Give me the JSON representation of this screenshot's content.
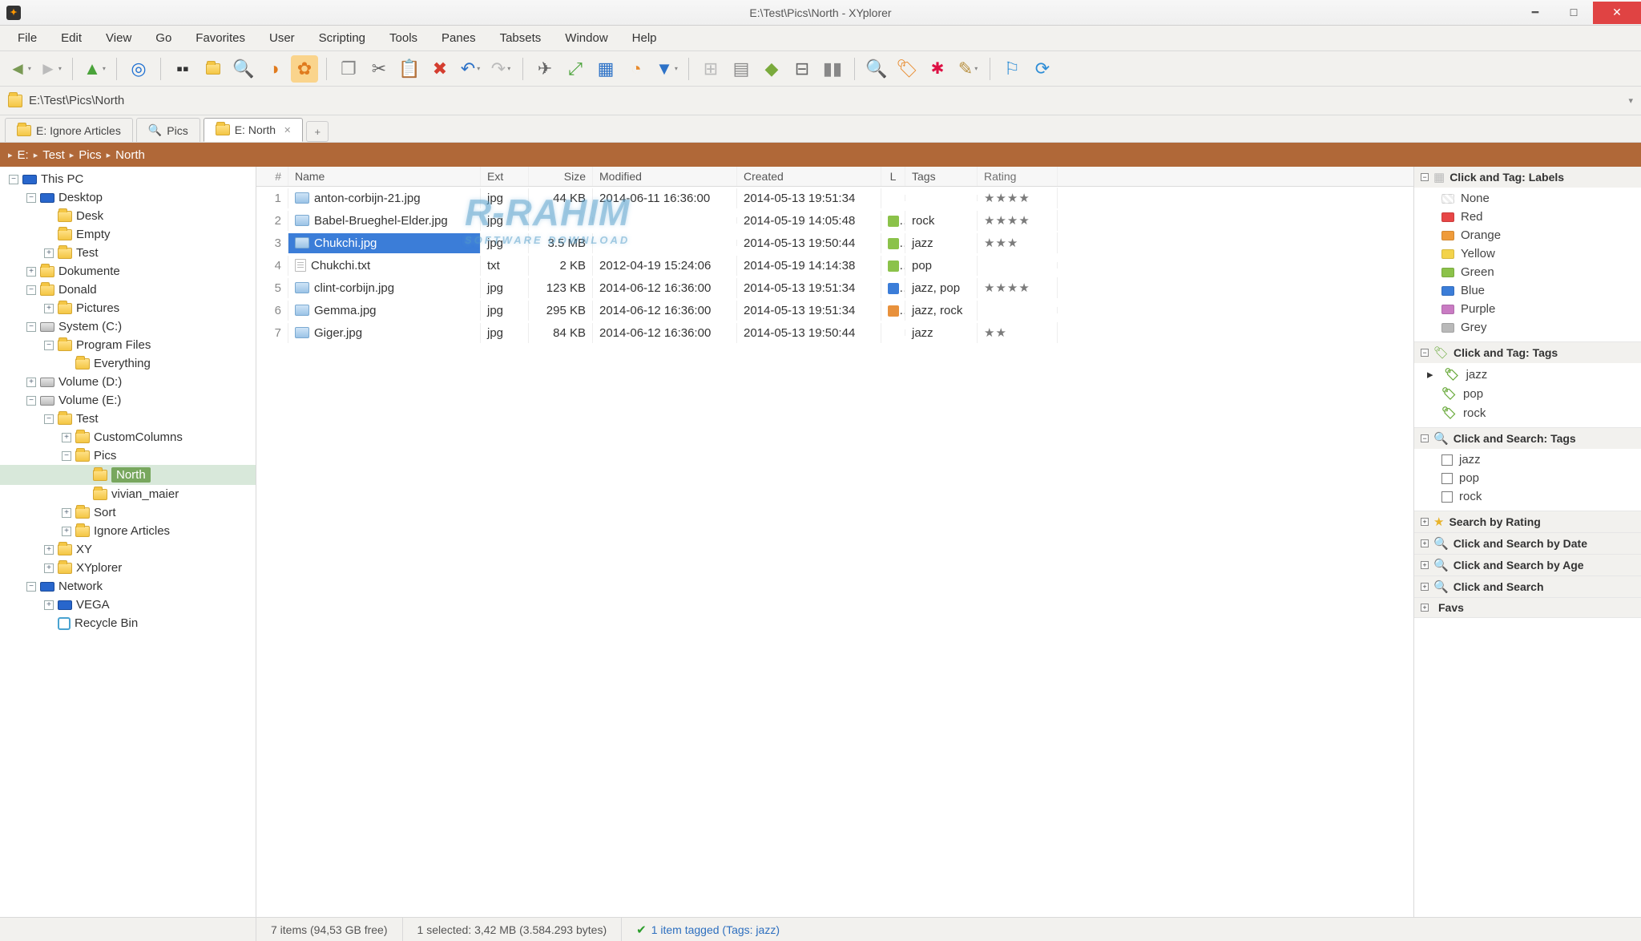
{
  "title": "E:\\Test\\Pics\\North - XYplorer",
  "menu": [
    "File",
    "Edit",
    "View",
    "Go",
    "Favorites",
    "User",
    "Scripting",
    "Tools",
    "Panes",
    "Tabsets",
    "Window",
    "Help"
  ],
  "address": "E:\\Test\\Pics\\North",
  "tabs": [
    {
      "label": "E: Ignore Articles",
      "icon": "folder",
      "active": false
    },
    {
      "label": "Pics",
      "icon": "search",
      "active": false
    },
    {
      "label": "E: North",
      "icon": "folder",
      "active": true,
      "closable": true
    }
  ],
  "breadcrumb": [
    "E:",
    "Test",
    "Pics",
    "North"
  ],
  "tree": [
    {
      "d": 0,
      "t": "-",
      "i": "monitor",
      "l": "This PC"
    },
    {
      "d": 1,
      "t": "-",
      "i": "monitor",
      "l": "Desktop"
    },
    {
      "d": 2,
      "t": " ",
      "i": "folder",
      "l": "Desk"
    },
    {
      "d": 2,
      "t": " ",
      "i": "folder",
      "l": "Empty"
    },
    {
      "d": 2,
      "t": "+",
      "i": "folder",
      "l": "Test"
    },
    {
      "d": 1,
      "t": "+",
      "i": "folder",
      "l": "Dokumente"
    },
    {
      "d": 1,
      "t": "-",
      "i": "folder",
      "l": "Donald"
    },
    {
      "d": 2,
      "t": "+",
      "i": "folder",
      "l": "Pictures"
    },
    {
      "d": 1,
      "t": "-",
      "i": "drive",
      "l": "System (C:)"
    },
    {
      "d": 2,
      "t": "-",
      "i": "folder",
      "l": "Program Files"
    },
    {
      "d": 3,
      "t": " ",
      "i": "folder",
      "l": "Everything"
    },
    {
      "d": 1,
      "t": "+",
      "i": "drive",
      "l": "Volume (D:)"
    },
    {
      "d": 1,
      "t": "-",
      "i": "drive",
      "l": "Volume (E:)"
    },
    {
      "d": 2,
      "t": "-",
      "i": "folder",
      "l": "Test"
    },
    {
      "d": 3,
      "t": "+",
      "i": "folder",
      "l": "CustomColumns"
    },
    {
      "d": 3,
      "t": "-",
      "i": "folder",
      "l": "Pics"
    },
    {
      "d": 4,
      "t": " ",
      "i": "folder",
      "l": "North",
      "sel": true
    },
    {
      "d": 4,
      "t": " ",
      "i": "folder",
      "l": "vivian_maier"
    },
    {
      "d": 3,
      "t": "+",
      "i": "folder",
      "l": "Sort"
    },
    {
      "d": 3,
      "t": "+",
      "i": "folder",
      "l": "Ignore Articles"
    },
    {
      "d": 2,
      "t": "+",
      "i": "folder",
      "l": "XY"
    },
    {
      "d": 2,
      "t": "+",
      "i": "folder",
      "l": "XYplorer"
    },
    {
      "d": 1,
      "t": "-",
      "i": "monitor",
      "l": "Network"
    },
    {
      "d": 2,
      "t": "+",
      "i": "monitor",
      "l": "VEGA"
    },
    {
      "d": 2,
      "t": " ",
      "i": "recycle",
      "l": "Recycle Bin"
    }
  ],
  "columns": [
    "#",
    "Name",
    "Ext",
    "Size",
    "Modified",
    "Created",
    "L",
    "Tags",
    "Rating"
  ],
  "files": [
    {
      "n": 1,
      "name": "anton-corbijn-21.jpg",
      "ext": "jpg",
      "size": "44 KB",
      "mod": "2014-06-11 16:36:00",
      "cre": "2014-05-13 19:51:34",
      "lc": "",
      "tags": "",
      "rating": 4,
      "ic": "img"
    },
    {
      "n": 2,
      "name": "Babel-Brueghel-Elder.jpg",
      "ext": "jpg",
      "size": "",
      "mod": "",
      "cre": "2014-05-19 14:05:48",
      "lc": "#8bc24a",
      "tags": "rock",
      "rating": 4,
      "ic": "img"
    },
    {
      "n": 3,
      "name": "Chukchi.jpg",
      "ext": "jpg",
      "size": "3.5 MB",
      "mod": "",
      "cre": "2014-05-13 19:50:44",
      "lc": "#8bc24a",
      "tags": "jazz",
      "rating": 3,
      "ic": "img",
      "sel": true
    },
    {
      "n": 4,
      "name": "Chukchi.txt",
      "ext": "txt",
      "size": "2 KB",
      "mod": "2012-04-19 15:24:06",
      "cre": "2014-05-19 14:14:38",
      "lc": "#8bc24a",
      "tags": "pop",
      "rating": 0,
      "ic": "txt"
    },
    {
      "n": 5,
      "name": "clint-corbijn.jpg",
      "ext": "jpg",
      "size": "123 KB",
      "mod": "2014-06-12 16:36:00",
      "cre": "2014-05-13 19:51:34",
      "lc": "#3b7dd8",
      "tags": "jazz, pop",
      "rating": 4,
      "ic": "img"
    },
    {
      "n": 6,
      "name": "Gemma.jpg",
      "ext": "jpg",
      "size": "295 KB",
      "mod": "2014-06-12 16:36:00",
      "cre": "2014-05-13 19:51:34",
      "lc": "#e8913c",
      "tags": "jazz, rock",
      "rating": 0,
      "ic": "img"
    },
    {
      "n": 7,
      "name": "Giger.jpg",
      "ext": "jpg",
      "size": "84 KB",
      "mod": "2014-06-12 16:36:00",
      "cre": "2014-05-13 19:50:44",
      "lc": "",
      "tags": "jazz",
      "rating": 2,
      "ic": "img"
    }
  ],
  "labels_head": "Click and Tag: Labels",
  "labels": [
    {
      "name": "None",
      "color": "none"
    },
    {
      "name": "Red",
      "color": "#e74646"
    },
    {
      "name": "Orange",
      "color": "#ef9b3a"
    },
    {
      "name": "Yellow",
      "color": "#f3d34b"
    },
    {
      "name": "Green",
      "color": "#8bc24a"
    },
    {
      "name": "Blue",
      "color": "#3b7dd8"
    },
    {
      "name": "Purple",
      "color": "#c97bc3"
    },
    {
      "name": "Grey",
      "color": "#b9b9b9"
    }
  ],
  "tags_head": "Click and Tag: Tags",
  "tags": [
    "jazz",
    "pop",
    "rock"
  ],
  "searchtags_head": "Click and Search: Tags",
  "searchtags": [
    "jazz",
    "pop",
    "rock"
  ],
  "sections": [
    {
      "icon": "star",
      "label": "Search by Rating"
    },
    {
      "icon": "search",
      "label": "Click and Search by Date"
    },
    {
      "icon": "search",
      "label": "Click and Search by Age"
    },
    {
      "icon": "search",
      "label": "Click and Search"
    },
    {
      "icon": "",
      "label": "Favs"
    }
  ],
  "status": {
    "items": "7 items (94,53 GB free)",
    "selected": "1 selected: 3,42 MB (3.584.293 bytes)",
    "tagged": "1 item tagged (Tags: jazz)"
  }
}
